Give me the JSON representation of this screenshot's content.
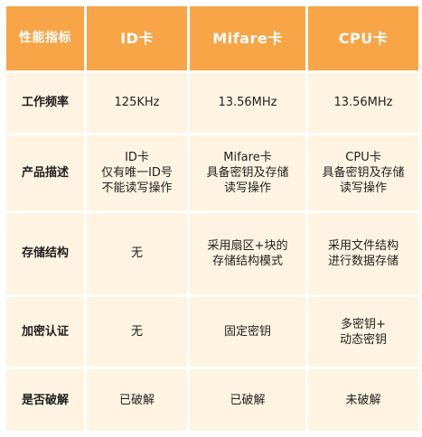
{
  "colors": {
    "header_bg": "#f7a547",
    "header_text": "#ffffff",
    "cell_bg": "#fff4e2",
    "text": "#1f1f1f"
  },
  "table": {
    "headers": [
      "性能指标",
      "ID卡",
      "Mifare卡",
      "CPU卡"
    ],
    "rows": [
      {
        "label": "工作频率",
        "cells": [
          [
            "125KHz"
          ],
          [
            "13.56MHz"
          ],
          [
            "13.56MHz"
          ]
        ]
      },
      {
        "label": "产品描述",
        "cells": [
          [
            "ID卡",
            "仅有唯一ID号",
            "不能读写操作"
          ],
          [
            "Mifare卡",
            "具备密钥及存储",
            "读写操作"
          ],
          [
            "CPU卡",
            "具备密钥及存储",
            "读写操作"
          ]
        ]
      },
      {
        "label": "存储结构",
        "cells": [
          [
            "无"
          ],
          [
            "采用扇区+块的",
            "存储结构模式"
          ],
          [
            "采用文件结构",
            "进行数据存储"
          ]
        ]
      },
      {
        "label": "加密认证",
        "cells": [
          [
            "无"
          ],
          [
            "固定密钥"
          ],
          [
            "多密钥+",
            "动态密钥"
          ]
        ]
      },
      {
        "label": "是否破解",
        "cells": [
          [
            "已破解"
          ],
          [
            "已破解"
          ],
          [
            "未破解"
          ]
        ]
      }
    ]
  }
}
